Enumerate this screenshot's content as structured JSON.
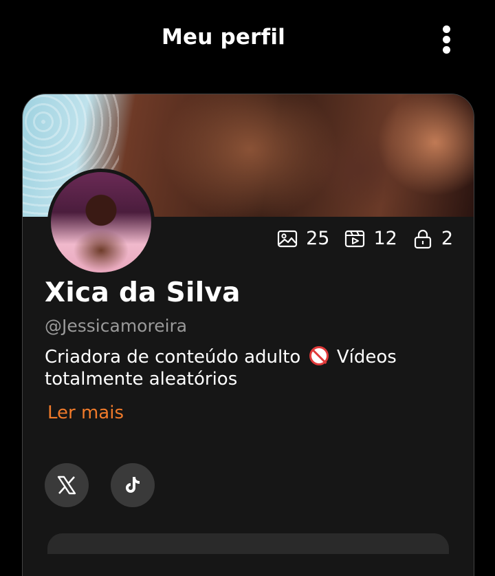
{
  "header": {
    "title": "Meu perfil",
    "menu_icon": "more-vertical-icon"
  },
  "profile": {
    "name": "Xica da Silva",
    "handle": "@Jessicamoreira",
    "bio_part1": "Criadora de conteúdo adulto",
    "bio_part2": " Vídeos totalmente aleatórios",
    "bio_icon": "adult-18-icon",
    "read_more": "Ler mais"
  },
  "stats": [
    {
      "icon": "image-icon",
      "value": "25"
    },
    {
      "icon": "video-icon",
      "value": "12"
    },
    {
      "icon": "lock-icon",
      "value": "2"
    }
  ],
  "social": [
    {
      "icon": "x-twitter-icon"
    },
    {
      "icon": "tiktok-icon"
    }
  ],
  "colors": {
    "background": "#000000",
    "card": "#161616",
    "accent": "#f07a2a",
    "muted": "#9a9a9a"
  }
}
